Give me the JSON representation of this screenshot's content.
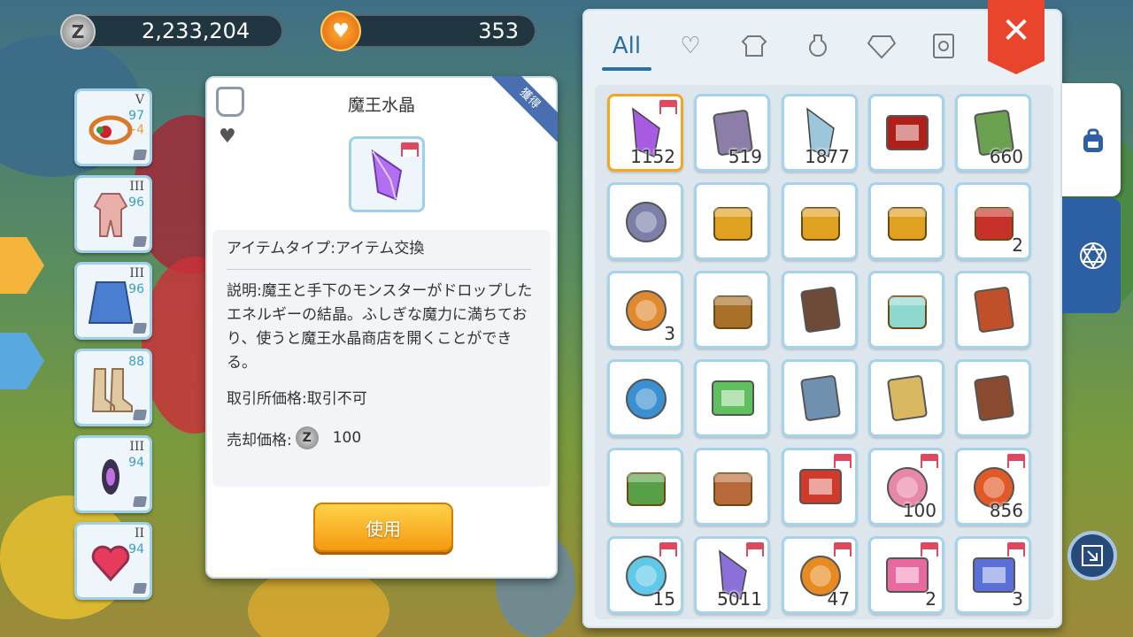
{
  "currency": {
    "zeny": "2,233,204",
    "zeny_icon": "zeny-coin-icon",
    "cat_coin": "353",
    "cat_icon": "cat-coin-icon"
  },
  "equipment": [
    {
      "rank": "V",
      "level": "97",
      "plus": "+4",
      "icon": "wreath-icon"
    },
    {
      "rank": "III",
      "level": "96",
      "icon": "bodysuit-icon"
    },
    {
      "rank": "III",
      "level": "96",
      "icon": "cape-icon"
    },
    {
      "rank": "",
      "level": "88",
      "icon": "boots-icon"
    },
    {
      "rank": "III",
      "level": "94",
      "icon": "amulet-icon"
    },
    {
      "rank": "II",
      "level": "94",
      "icon": "heart-ring-icon"
    }
  ],
  "tooltip": {
    "title": "魔王水晶",
    "ribbon": "獲得",
    "item_type": "アイテムタイプ:アイテム交換",
    "description": "説明:魔王と手下のモンスターがドロップしたエネルギーの結晶。ふしぎな魔力に満ちており、使うと魔王水晶商店を開くことができる。",
    "trade_price": "取引所価格:取引不可",
    "sell_label": "売却価格:",
    "zeny_symbol": "Z",
    "sell_value": "100",
    "use_button": "使用"
  },
  "inventory": {
    "tabs": [
      {
        "label": "All",
        "icon": "all-tab"
      },
      {
        "label": "",
        "icon": "heart-tab-icon"
      },
      {
        "label": "",
        "icon": "armor-tab-icon"
      },
      {
        "label": "",
        "icon": "potion-tab-icon"
      },
      {
        "label": "",
        "icon": "gem-tab-icon"
      },
      {
        "label": "",
        "icon": "card-tab-icon"
      }
    ],
    "close_icon": "close-icon",
    "items": [
      {
        "icon": "purple-crystal-icon",
        "qty": "1152",
        "shop": true,
        "color": "#a65be0"
      },
      {
        "icon": "butterfly-wing-icon",
        "qty": "519",
        "shop": false,
        "color": "#8b7ea8"
      },
      {
        "icon": "white-feather-icon",
        "qty": "1877",
        "shop": false,
        "color": "#9ec6da"
      },
      {
        "icon": "red-card-icon",
        "qty": "",
        "shop": false,
        "color": "#b0201a"
      },
      {
        "icon": "leaf-icon",
        "qty": "660",
        "shop": false,
        "color": "#6aa050"
      },
      {
        "icon": "sword-badge-icon",
        "qty": "",
        "shop": false,
        "color": "#7c80a8"
      },
      {
        "icon": "gold-chest-icon",
        "qty": "",
        "shop": false,
        "color": "#e0a020"
      },
      {
        "icon": "gold-chest-icon",
        "qty": "",
        "shop": false,
        "color": "#e0a020"
      },
      {
        "icon": "gold-chest-icon",
        "qty": "",
        "shop": false,
        "color": "#e0a020"
      },
      {
        "icon": "red-treasure-chest-icon",
        "qty": "2",
        "shop": false,
        "color": "#c8302a"
      },
      {
        "icon": "winged-star-badge-icon",
        "qty": "3",
        "shop": false,
        "color": "#e08a30"
      },
      {
        "icon": "backpack-icon",
        "qty": "",
        "shop": false,
        "color": "#a87028"
      },
      {
        "icon": "book-icon",
        "qty": "",
        "shop": false,
        "color": "#6e4a38"
      },
      {
        "icon": "gift-box-icon",
        "qty": "",
        "shop": false,
        "color": "#8fd8d0"
      },
      {
        "icon": "red-book-icon",
        "qty": "",
        "shop": false,
        "color": "#c0502a"
      },
      {
        "icon": "orb-staff-icon",
        "qty": "",
        "shop": false,
        "color": "#3a90d0"
      },
      {
        "icon": "green-ticket-icon",
        "qty": "",
        "shop": false,
        "color": "#60c060"
      },
      {
        "icon": "open-book-icon",
        "qty": "",
        "shop": false,
        "color": "#7090b0"
      },
      {
        "icon": "golden-frame-icon",
        "qty": "",
        "shop": false,
        "color": "#d8b860"
      },
      {
        "icon": "brown-journal-icon",
        "qty": "",
        "shop": false,
        "color": "#8a4a30"
      },
      {
        "icon": "mystery-box-icon",
        "qty": "",
        "shop": false,
        "color": "#58a048"
      },
      {
        "icon": "satchel-icon",
        "qty": "",
        "shop": false,
        "color": "#b86a3a"
      },
      {
        "icon": "red-folder-icon",
        "qty": "",
        "shop": true,
        "color": "#d03a2a"
      },
      {
        "icon": "pink-rose-icon",
        "qty": "100",
        "shop": true,
        "color": "#e888a8"
      },
      {
        "icon": "red-p-coin-icon",
        "qty": "856",
        "shop": true,
        "color": "#e05a28"
      },
      {
        "icon": "snowflake-icon",
        "qty": "15",
        "shop": true,
        "color": "#60c8e8"
      },
      {
        "icon": "purple-blade-icon",
        "qty": "5011",
        "shop": true,
        "color": "#8a70d8"
      },
      {
        "icon": "maple-coin-icon",
        "qty": "47",
        "shop": true,
        "color": "#e88a20"
      },
      {
        "icon": "pink-folder-icon",
        "qty": "2",
        "shop": true,
        "color": "#e868a0"
      },
      {
        "icon": "blue-folder-icon",
        "qty": "3",
        "shop": true,
        "color": "#5a70d8"
      }
    ]
  },
  "side_tabs": [
    {
      "icon": "backpack-tab-icon"
    },
    {
      "icon": "hexagram-tab-icon"
    }
  ],
  "corner_button_icon": "exit-corner-icon"
}
